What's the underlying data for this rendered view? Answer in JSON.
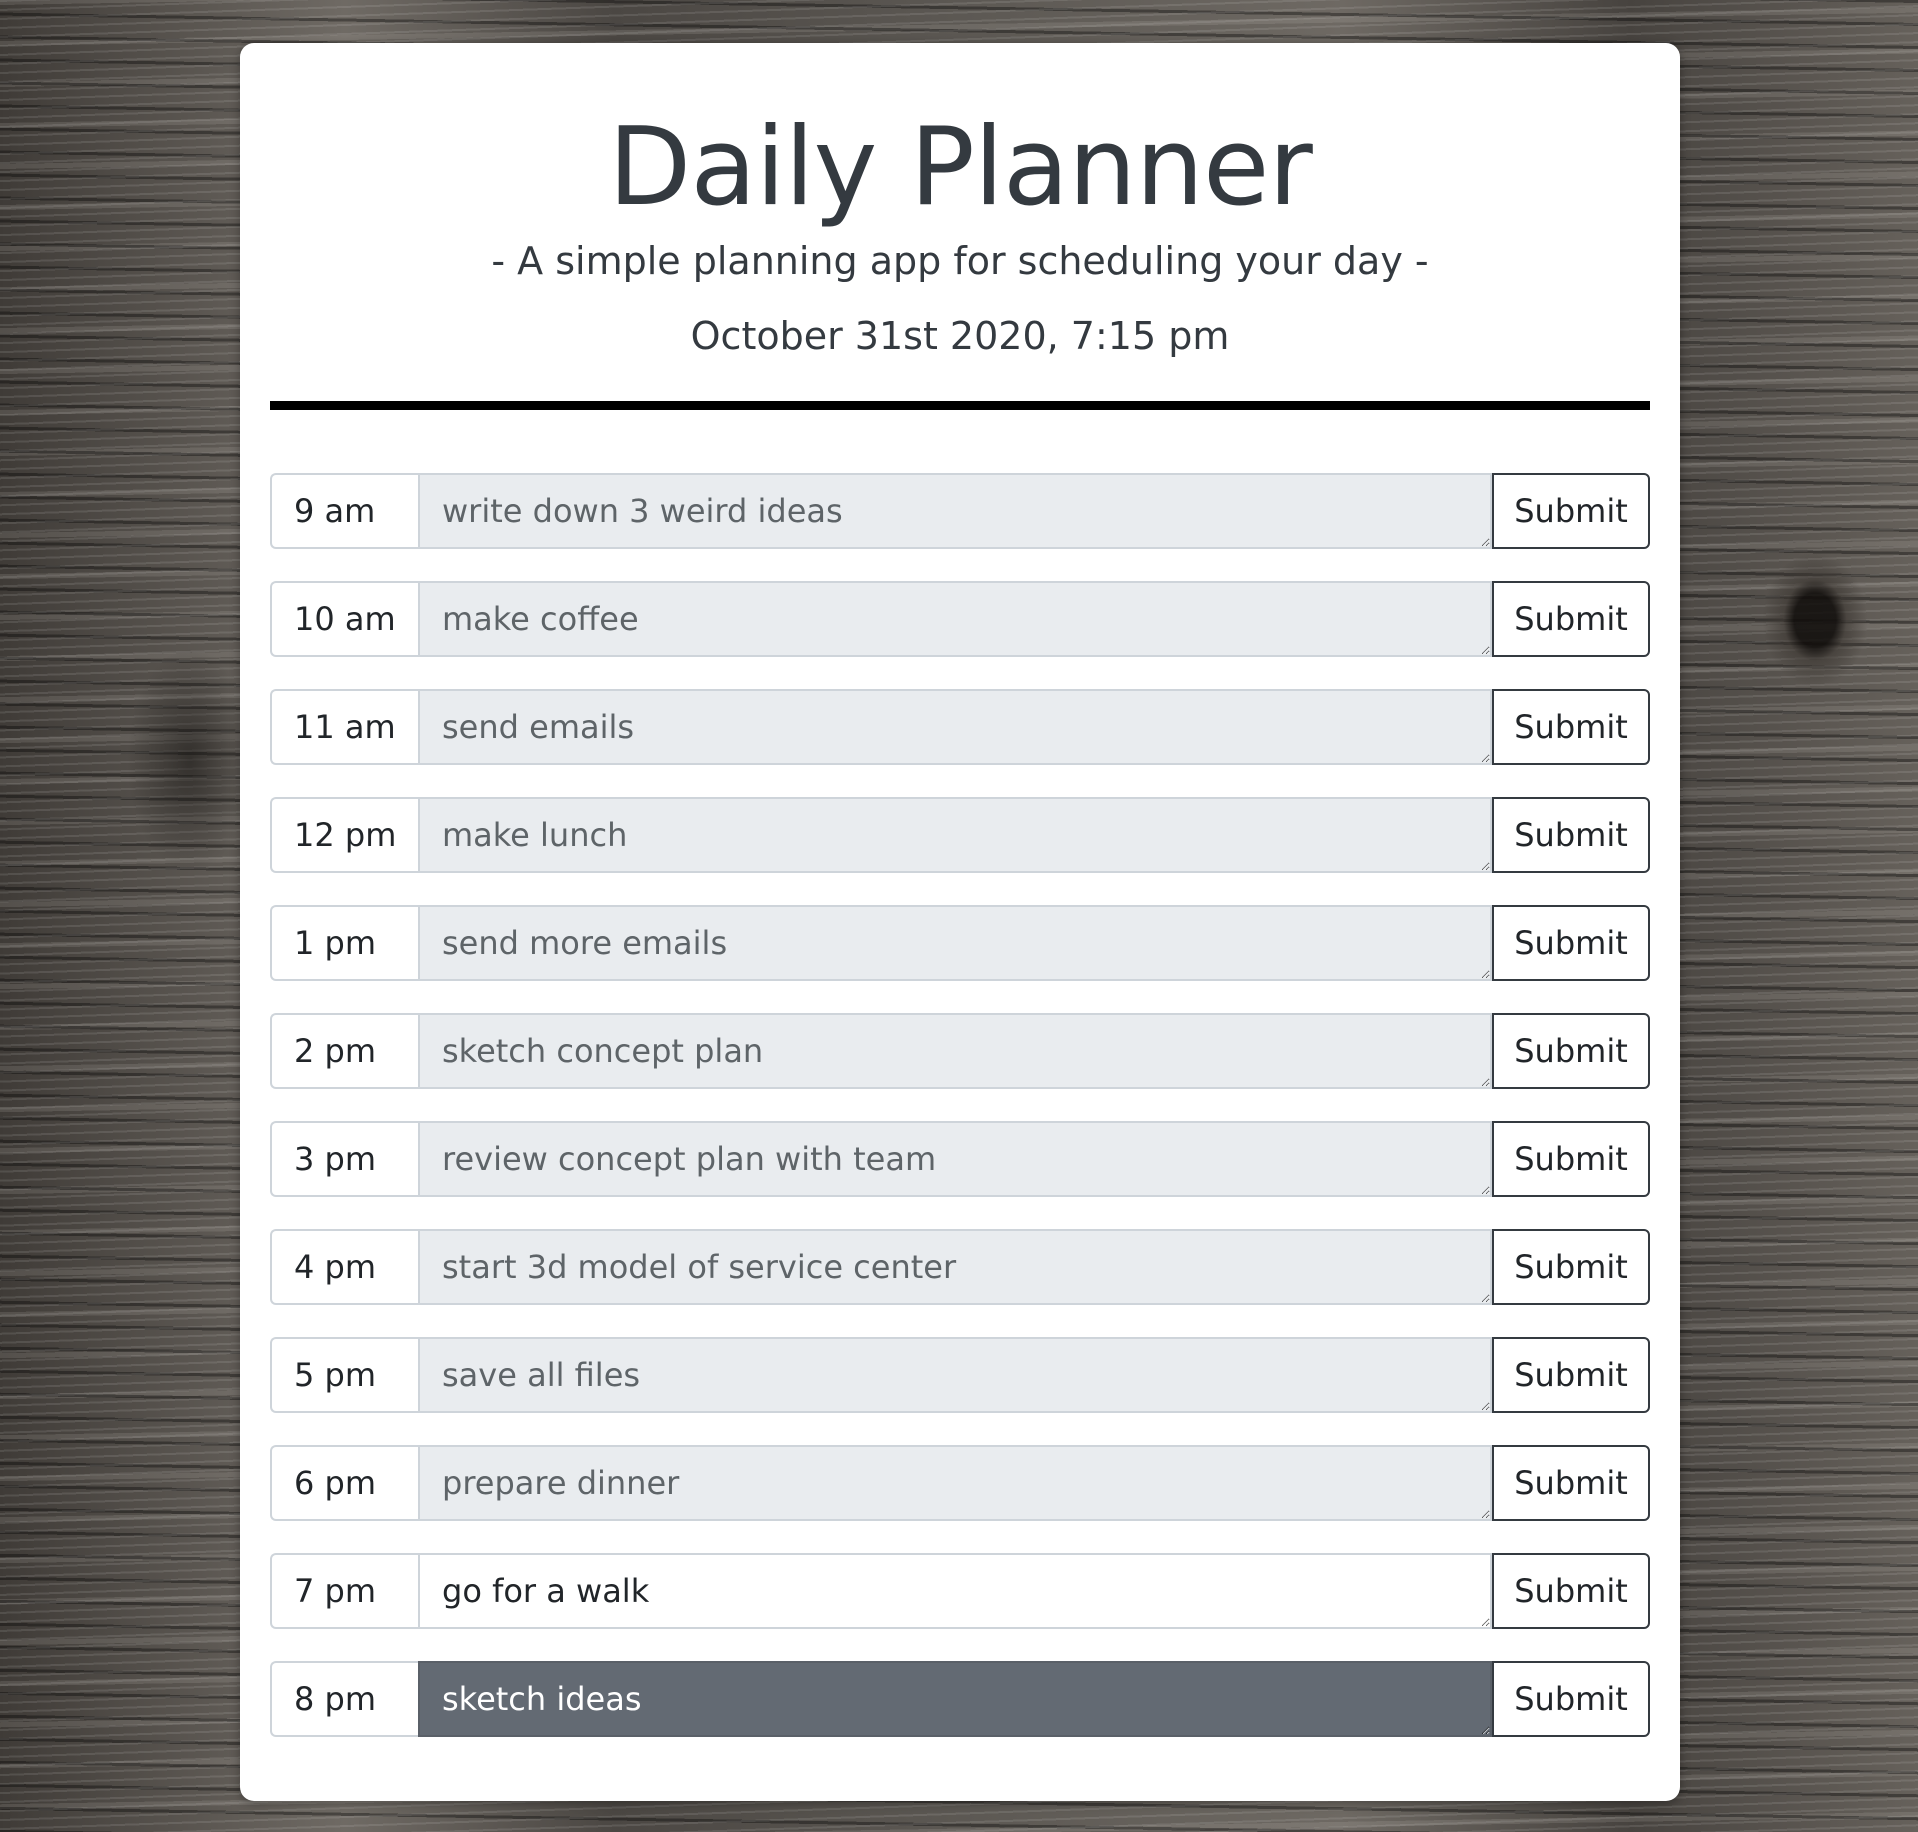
{
  "header": {
    "title": "Daily Planner",
    "subtitle": "- A simple planning app for scheduling your day -",
    "datetime": "October 31st 2020, 7:15 pm"
  },
  "colors": {
    "past_row": "#e9ecef",
    "present_row": "#ffffff",
    "future_row": "#636a73"
  },
  "rows": [
    {
      "hour": "9 am",
      "task": "write down 3 weird ideas",
      "state": "past",
      "submit_label": "Submit"
    },
    {
      "hour": "10 am",
      "task": "make coffee",
      "state": "past",
      "submit_label": "Submit"
    },
    {
      "hour": "11 am",
      "task": "send emails",
      "state": "past",
      "submit_label": "Submit"
    },
    {
      "hour": "12 pm",
      "task": "make lunch",
      "state": "past",
      "submit_label": "Submit"
    },
    {
      "hour": "1 pm",
      "task": "send more emails",
      "state": "past",
      "submit_label": "Submit"
    },
    {
      "hour": "2 pm",
      "task": "sketch concept plan",
      "state": "past",
      "submit_label": "Submit"
    },
    {
      "hour": "3 pm",
      "task": "review concept plan with team",
      "state": "past",
      "submit_label": "Submit"
    },
    {
      "hour": "4 pm",
      "task": "start 3d model of service center",
      "state": "past",
      "submit_label": "Submit"
    },
    {
      "hour": "5 pm",
      "task": "save all files",
      "state": "past",
      "submit_label": "Submit"
    },
    {
      "hour": "6 pm",
      "task": "prepare dinner",
      "state": "past",
      "submit_label": "Submit"
    },
    {
      "hour": "7 pm",
      "task": "go for a walk",
      "state": "present",
      "submit_label": "Submit"
    },
    {
      "hour": "8 pm",
      "task": "sketch ideas",
      "state": "future",
      "submit_label": "Submit"
    }
  ]
}
